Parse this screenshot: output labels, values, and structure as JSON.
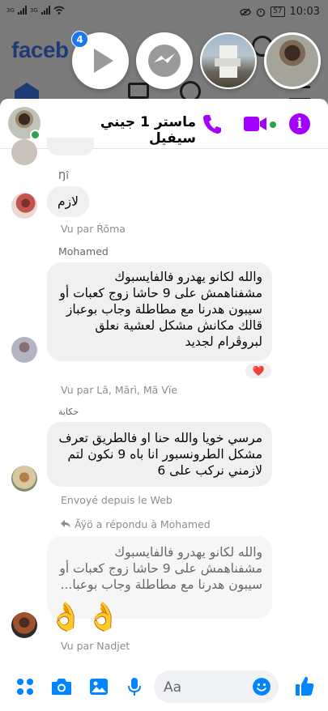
{
  "status_bar": {
    "left_labels": [
      "3G",
      "3G"
    ],
    "battery": "57",
    "time": "10:03"
  },
  "background_app": {
    "logo": "faceb"
  },
  "chat_heads": {
    "badge_count": "4"
  },
  "header": {
    "contact_name": "ماستر 1 جيني سيفيل",
    "colors": {
      "accent": "#a300ff",
      "online": "#31a24c"
    }
  },
  "messages": [
    {
      "sender": "Ŋî",
      "text": "لازم",
      "seen": "Vu par Ŕõma"
    },
    {
      "sender": "Mohamed",
      "lines": [
        "والله لكانو يهدرو فالفايسبوك",
        "مشفناهمش على 9 حاشا زوج كعبات أو",
        "سيبون هدرنا مع مطاطلة وجاب بوعباز",
        "قالك مكانش مشكل لعشية نعلق",
        "لبروڤرام لجديد"
      ],
      "reaction": "❤️",
      "seen": "Vu par Lã, Mãrì, Mã Vïe"
    },
    {
      "sender": "حكاية",
      "lines": [
        "مرسي خويا والله حنا او فالطريق تعرف",
        "مشكل الطرونسبور انا باه 9 نكون لتم",
        "لازمني نركب على 6"
      ],
      "meta": "Envoyé depuis le Web"
    },
    {
      "reply_header": "Ăÿö a répondu à Mohamed",
      "quoted_lines": [
        "والله لكانو يهدرو فالفايسبوك",
        "مشفناهمش على 9 حاشا زوج كعبات أو",
        "سيبون هدرنا مع مطاطلة وجاب بوعبا..."
      ],
      "emoji": "👌👌",
      "seen": "Vu par Nadjet"
    }
  ],
  "composer": {
    "placeholder": "Aa",
    "colors": {
      "icons": "#0084ff"
    }
  }
}
